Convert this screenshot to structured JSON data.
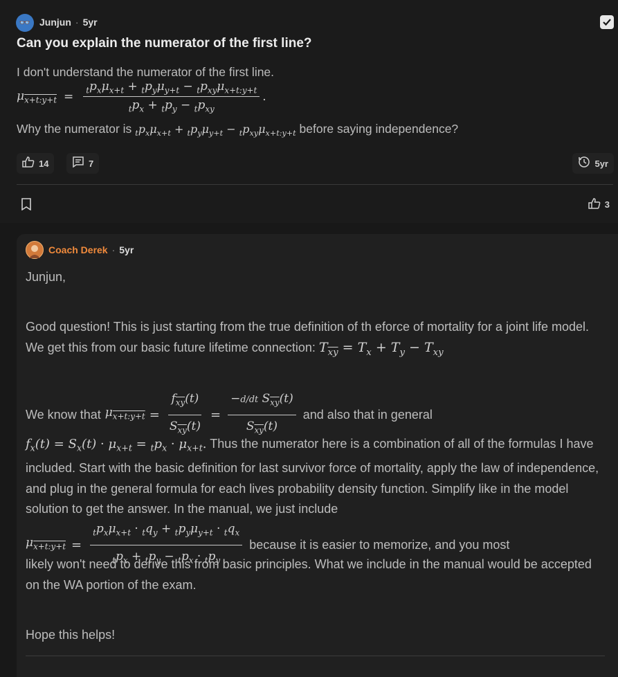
{
  "question": {
    "author": "Junjun",
    "time": "5yr",
    "title": "Can you explain the numerator of the first line?",
    "body": "I don't understand the numerator of the first line.",
    "why_prefix": "Why the numerator is",
    "why_suffix": "before saying independence?",
    "likes": "14",
    "comments": "7",
    "history_time": "5yr",
    "footer_likes": "3"
  },
  "answer": {
    "author": "Coach Derek",
    "time": "5yr",
    "greeting": "Junjun,",
    "p1": "Good question! This is just starting from the true definition of th eforce of mortality for a joint life model. We get this from our basic future lifetime connection:",
    "p2_prefix": "We know that",
    "p2_mid": "and also that in general",
    "p3": "Thus the numerator here is a combination of all of the formulas I have included. Start with the basic definition for last survivor force of mortality, apply the law of independence, and plug in the general formula for each lives probability density function. Simplify like in the model solution to get the answer. In the manual, we just include",
    "p4_suffix": "because it is easier to memorize, and you most",
    "p5": "likely won't need to derive this from basic principles. What we include in the manual would be accepted on the WA portion of the exam.",
    "closing": "Hope this helps!"
  },
  "icons": [
    "avatar",
    "check-badge-icon",
    "thumbs-up-icon",
    "comment-icon",
    "history-icon",
    "bookmark-icon"
  ],
  "colors": {
    "background": "#181818",
    "accent_name": "#f08a3c",
    "text": "#bdbdbd"
  }
}
